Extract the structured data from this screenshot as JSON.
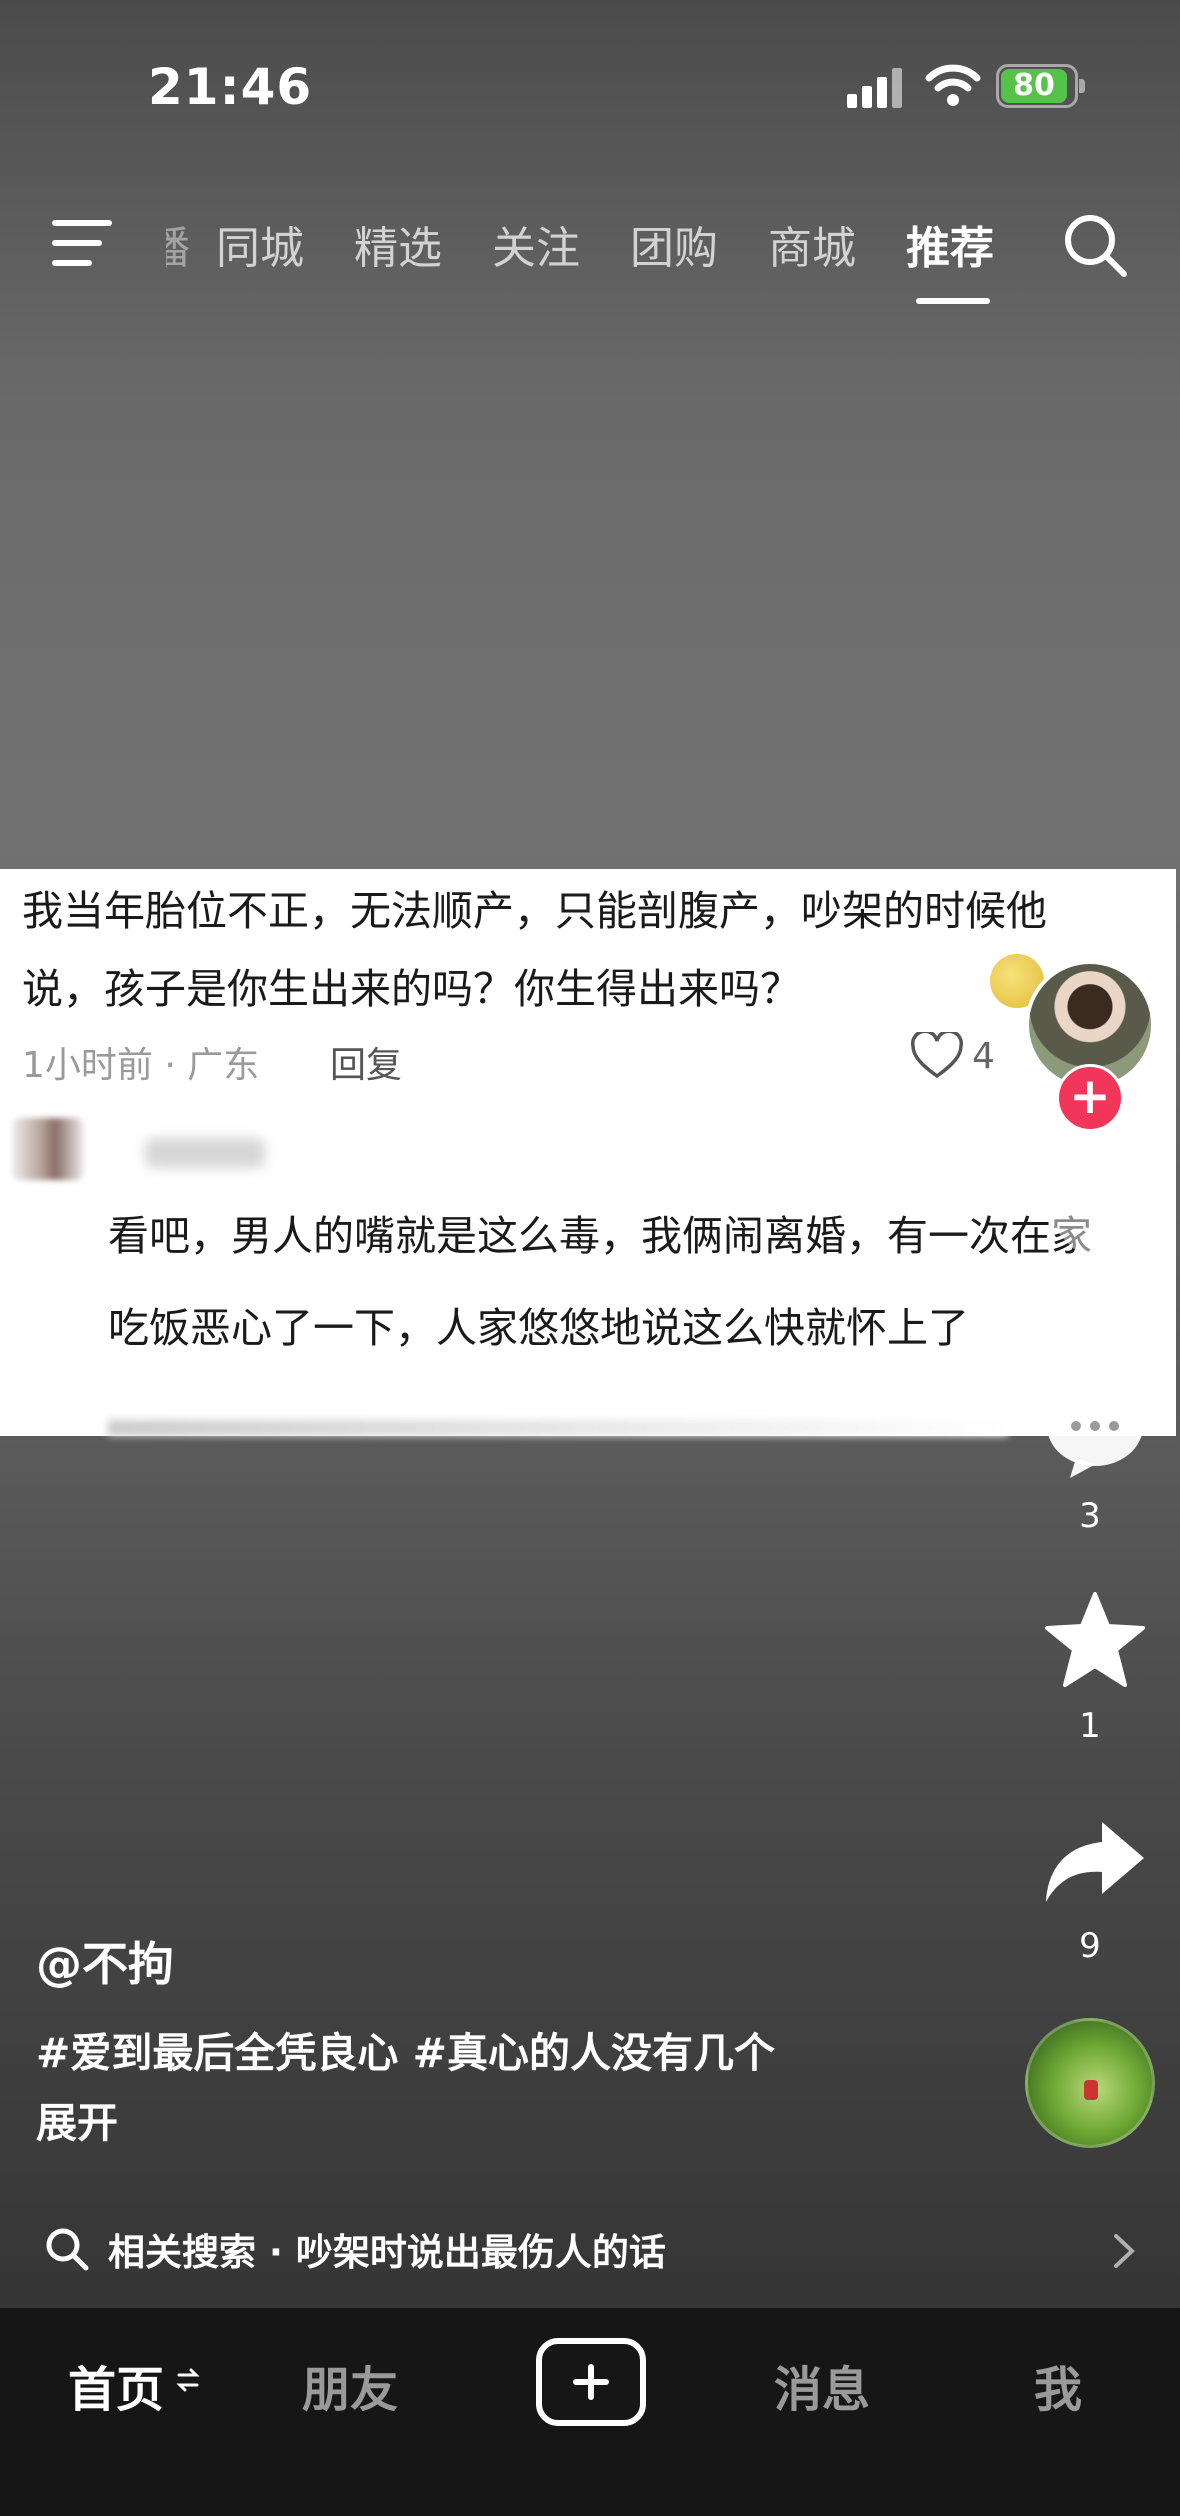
{
  "status_bar": {
    "time": "21:46",
    "battery": "80"
  },
  "top_nav": {
    "partial_tab": "播",
    "tabs": [
      "同城",
      "精选",
      "关注",
      "团购",
      "商城",
      "推荐"
    ],
    "active_index": 5
  },
  "comment_card": {
    "comment1": {
      "text": "我当年胎位不正，无法顺产，只能剖腹产，吵架的时候他说，孩子是你生出来的吗？你生得出来吗？",
      "meta": "1小时前 · 广东",
      "reply": "回复",
      "likes": "4"
    },
    "comment2": {
      "text": "看吧，男人的嘴就是这么毒，我俩闹离婚，有一次在家吃饭恶心了一下，人家悠悠地说这么快就怀上了"
    }
  },
  "right_rail": {
    "comments_count": "3",
    "favorites_count": "1",
    "shares_count": "9"
  },
  "post": {
    "author": "@不拘",
    "caption_tags": "#爱到最后全凭良心 #真心的人没有几个",
    "expand": "展开"
  },
  "related_search": {
    "text": "相关搜索 · 吵架时说出最伤人的话"
  },
  "bottom_bar": {
    "home": "首页",
    "friends": "朋友",
    "messages": "消息",
    "me": "我"
  },
  "colors": {
    "accent_red": "#f2365a",
    "battery_green": "#55c24a"
  },
  "icons": [
    "menu-icon",
    "search-icon",
    "heart-icon",
    "comment-icon",
    "star-icon",
    "share-icon",
    "plus-icon",
    "chevron-right-icon"
  ]
}
